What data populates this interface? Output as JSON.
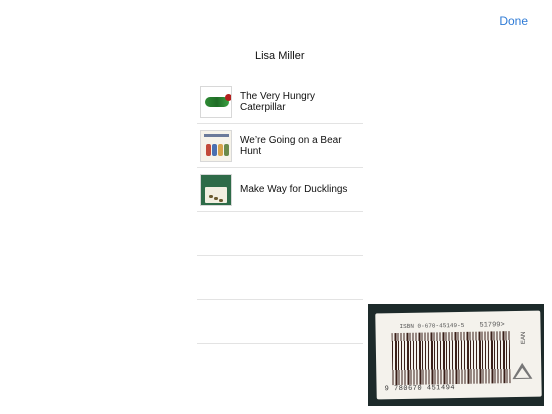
{
  "header": {
    "done_label": "Done",
    "user_name": "Lisa Miller"
  },
  "books": [
    {
      "title": "The Very Hungry Caterpillar",
      "cover": "caterpillar-cover"
    },
    {
      "title": "We’re Going on a Bear Hunt",
      "cover": "bear-hunt-cover"
    },
    {
      "title": "Make Way for Ducklings",
      "cover": "ducklings-cover"
    }
  ],
  "scanner": {
    "isbn_top": "ISBN 0-670-45149-5",
    "price_code": "51799>",
    "isbn_bottom": "9 780670 451494",
    "ean_label": "EAN"
  },
  "colors": {
    "accent": "#2f7bd6",
    "divider": "#e3e3e3"
  }
}
